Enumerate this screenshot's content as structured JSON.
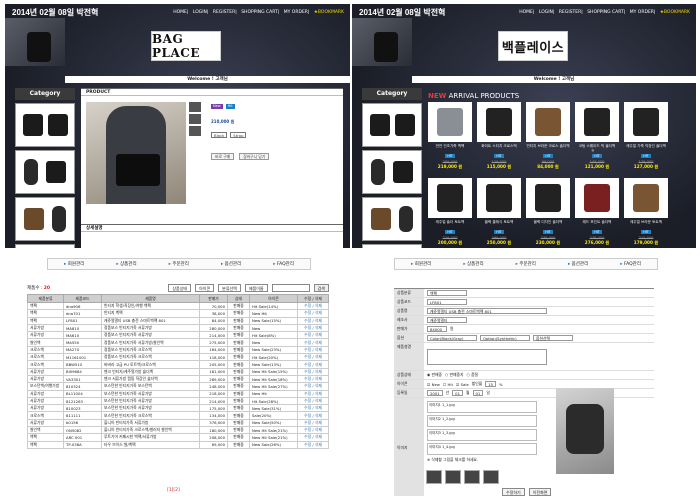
{
  "date": "2014년 02월 08일 박전혁",
  "topnav": [
    "HOME",
    "LOGIN",
    "REGISTER",
    "SHOPPING CART",
    "MY ORDER",
    "★BOOKMARK"
  ],
  "logo_en": "BAG PLACE",
  "logo_ko": "백플레이스",
  "welcome": "Welcome ! 고객님",
  "category": "Category",
  "product_section": "PRODUCT",
  "detail_section": "상세설명",
  "product_info": {
    "tag1": "New",
    "tag2": "Hit",
    "price": "210,000 원",
    "option1": "Black",
    "option2": "Strap",
    "btn_buy": "바로 구매",
    "btn_cart": "장바구니 담기"
  },
  "arrival_new": "NEW",
  "arrival_rest": "ARRIVAL PRODUCTS",
  "arrival_products": [
    {
      "name": "반전 인조가죽 백팩",
      "badge": "HIT",
      "old": "289,000",
      "price": "219,000 원"
    },
    {
      "name": "화이트 스티치 크로스백",
      "badge": "HIT",
      "old": "129,000",
      "price": "115,000 원"
    },
    {
      "name": "빈티지 브라운 크로스 숄더백",
      "badge": "HIT",
      "old": "99,000",
      "price": "84,000 원"
    },
    {
      "name": "코팅 스웨이드 빅 숄더백",
      "badge": "HIT",
      "old": "145,000",
      "price": "121,000 원"
    },
    {
      "name": "캐주얼 가죽 직장인 숄더백",
      "badge": "HIT",
      "old": "139,000",
      "price": "127,000 원"
    },
    {
      "name": "캐주얼 숄더 토트백",
      "badge": "HIT",
      "old": "229,000",
      "price": "200,000 원"
    },
    {
      "name": "블랙 클래식 토트백",
      "badge": "HIT",
      "old": "299,000",
      "price": "250,000 원"
    },
    {
      "name": "블랙 디자인 숄더백",
      "badge": "HIT",
      "old": "239,000",
      "price": "230,000 원"
    },
    {
      "name": "레드 포인트 숄더백",
      "badge": "HIT",
      "old": "276,000",
      "price": "276,000 원"
    },
    {
      "name": "캐주얼 브라운 토트백",
      "badge": "HIT",
      "old": "215,000",
      "price": "179,000 원"
    }
  ],
  "adminnav": [
    "회원관리",
    "상품관리",
    "주문관리",
    "옵션관리",
    "FAQ관리"
  ],
  "list": {
    "count_label": "제품수 : ",
    "count": "20",
    "filter1": "상품상태",
    "filter2": "아이콘",
    "filter3": "분류선택",
    "filter4": "제품이름",
    "search_btn": "검색",
    "headers": [
      "제품분류",
      "제품코드",
      "제품명",
      "판매가",
      "상태",
      "아이콘",
      "수정 / 삭제"
    ],
    "rows": [
      [
        "백팩",
        "dno906",
        "빈티지 학생/직장인/여행 백팩",
        "70,000",
        "판매중",
        "Hit Sale(14%)",
        "수정 / 삭제"
      ],
      [
        "백팩",
        "dno701",
        "빈티지 백팩",
        "38,000",
        "판매중",
        "New Hit",
        "수정 / 삭제"
      ],
      [
        "백팩",
        "LF801",
        "캐쥬얼멀티 USB 충전 스마트백팩 801",
        "84,000",
        "판매중",
        "New Sale(15%)",
        "수정 / 삭제"
      ],
      [
        "서류가방",
        "MA810",
        "정품보스 빈티지가죽 서류가방",
        "280,000",
        "판매중",
        "New",
        "수정 / 삭제"
      ],
      [
        "서류가방",
        "MA610",
        "정품보스 빈티지가죽 서류가방",
        "214,000",
        "판매중",
        "Hit Sale(8%)",
        "수정 / 삭제"
      ],
      [
        "쌀인백",
        "MA550",
        "정품보스 빈티지가죽 서류가방/쌀인백",
        "275,000",
        "판매중",
        "New",
        "수정 / 삭제"
      ],
      [
        "크로스백",
        "MA270",
        "정품보스 빈티지가죽 크로스백",
        "164,000",
        "판매중",
        "New Sale(23%)",
        "수정 / 삭제"
      ],
      [
        "크로스백",
        "M1161001",
        "정품보스 빈티지가죽 크로스백",
        "118,000",
        "판매중",
        "Hit Sale(20%)",
        "수정 / 삭제"
      ],
      [
        "크로스백",
        "BBW510",
        "바버라 고급 PU 토트백/크로스백",
        "205,000",
        "판매중",
        "New Sale(13%)",
        "수정 / 삭제"
      ],
      [
        "서류가방",
        "BI09684",
        "벤크 빈티지/캐주얼가방 숄더백",
        "181,000",
        "판매중",
        "New Hit Sale(15%)",
        "수정 / 삭제"
      ],
      [
        "서류가방",
        "VA3301",
        "벤크 서류가방 캠핑 직장인 숄더백",
        "289,000",
        "판매중",
        "New Hit Sale(18%)",
        "수정 / 삭제"
      ],
      [
        "보스턴백/여행가방",
        "810324",
        "보스턴한 빈티지가죽 보스턴백",
        "248,000",
        "판매중",
        "New Hit Sale(27%)",
        "수정 / 삭제"
      ],
      [
        "서류가방",
        "BL11004",
        "보스턴한 빈티지가죽 서류가방",
        "218,000",
        "판매중",
        "New Hit",
        "수정 / 삭제"
      ],
      [
        "서류가방",
        "8121263",
        "보스턴한 빈티지가죽 서류가방",
        "214,000",
        "판매중",
        "Hit Sale(28%)",
        "수정 / 삭제"
      ],
      [
        "서류가방",
        "810023",
        "보스턴한 빈티지가죽 서류가방",
        "175,000",
        "판매중",
        "New Sale(31%)",
        "수정 / 삭제"
      ],
      [
        "크로스백",
        "811111",
        "보스턴한 빈티지가죽 크로스백",
        "134,000",
        "판매중",
        "Sale(20%)",
        "수정 / 삭제"
      ],
      [
        "서류가방",
        "b0156",
        "올니아 빈티지가죽 서류가방",
        "376,000",
        "판매중",
        "New Sale(50%)",
        "수정 / 삭제"
      ],
      [
        "쌀인백",
        "ON5082",
        "올니아 빈티지가죽 크로스백/쌀러지 쌀인백",
        "180,000",
        "판매중",
        "New Hit Sale(21%)",
        "수정 / 삭제"
      ],
      [
        "백팩",
        "ARC 001",
        "루트기어 커패시한 백팩/서류가방",
        "208,000",
        "판매중",
        "New Hit Sale(21%)",
        "수정 / 삭제"
      ],
      [
        "백팩",
        "TP-038A",
        "타우 브이스 쌀/백팩",
        "69,000",
        "판매중",
        "New Sale(26%)",
        "수정 / 삭제"
      ]
    ],
    "pager": "[1][2]"
  },
  "form": {
    "rows": [
      {
        "label": "상품분류",
        "values": [
          "백팩"
        ]
      },
      {
        "label": "상품코드",
        "values": [
          "LF801"
        ]
      },
      {
        "label": "상품명",
        "values": [
          "캐쥬얼멀티 USB 충전 스마트백팩 801"
        ]
      },
      {
        "label": "제조사",
        "values": [
          "캐쥬얼멀티"
        ]
      },
      {
        "label": "판매가",
        "values": [
          "84000",
          "원"
        ]
      },
      {
        "label": "옵션",
        "values": [
          "Color(Black/Gray)",
          "Option(Synthetic)",
          "옵션선택"
        ]
      }
    ],
    "desc_label": "제품설명",
    "status_label": "상품상태",
    "status_values": [
      "판매중",
      "판매중지",
      "품절"
    ],
    "icon_label": "아이콘",
    "icon_values": [
      "New",
      "Hit",
      "Sale",
      "할인율",
      "15",
      "%"
    ],
    "date_label": "등록일",
    "date_values": [
      "2001",
      "년",
      "01",
      "월",
      "01",
      "일"
    ],
    "image_label": "이미지",
    "files": [
      "이미지1 1_1.jpg",
      "이미지2 1_2.jpg",
      "이미지3 1_3.jpg",
      "이미지4 1_4.jpg"
    ],
    "file_note": "※ 삭제할 그림을 체크를 하세요.",
    "buttons": [
      "수정하기",
      "이전화면"
    ]
  }
}
